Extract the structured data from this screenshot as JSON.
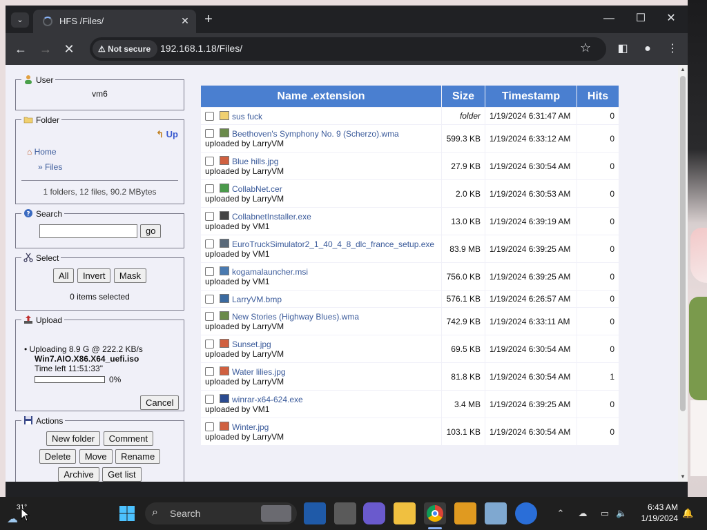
{
  "browser": {
    "tab_title": "HFS /Files/",
    "security_label": "Not secure",
    "url": "192.168.1.18/Files/"
  },
  "user_panel": {
    "legend": "User",
    "username": "vm6"
  },
  "folder_panel": {
    "legend": "Folder",
    "up_label": "Up",
    "home_label": "Home",
    "current_label": "» Files",
    "summary": "1 folders, 12 files, 90.2 MBytes"
  },
  "search_panel": {
    "legend": "Search",
    "go_label": "go",
    "query": ""
  },
  "select_panel": {
    "legend": "Select",
    "all_label": "All",
    "invert_label": "Invert",
    "mask_label": "Mask",
    "status": "0 items selected"
  },
  "upload_panel": {
    "legend": "Upload",
    "line1": "Uploading 8.9 G @ 222.2 KB/s",
    "filename": "Win7.AIO.X86.X64_uefi.iso",
    "time_left": "Time left 11:51:33\"",
    "progress_text": "0%",
    "progress_fraction": 0,
    "cancel_label": "Cancel"
  },
  "actions_panel": {
    "legend": "Actions",
    "new_folder": "New folder",
    "comment": "Comment",
    "delete": "Delete",
    "move": "Move",
    "rename": "Rename",
    "archive": "Archive",
    "get_list": "Get list"
  },
  "table": {
    "headers": [
      "Name .extension",
      "Size",
      "Timestamp",
      "Hits"
    ],
    "rows": [
      {
        "name": "sus fuck",
        "by": "",
        "size": "folder",
        "time": "1/19/2024 6:31:47 AM",
        "hits": "0",
        "icon": "folder-icon"
      },
      {
        "name": "Beethoven's Symphony No. 9 (Scherzo).wma",
        "by": "uploaded by LarryVM",
        "size": "599.3 KB",
        "time": "1/19/2024 6:33:12 AM",
        "hits": "0",
        "icon": "audio-file-icon"
      },
      {
        "name": "Blue hills.jpg",
        "by": "uploaded by LarryVM",
        "size": "27.9 KB",
        "time": "1/19/2024 6:30:54 AM",
        "hits": "0",
        "icon": "image-file-icon"
      },
      {
        "name": "CollabNet.cer",
        "by": "uploaded by LarryVM",
        "size": "2.0 KB",
        "time": "1/19/2024 6:30:53 AM",
        "hits": "0",
        "icon": "certificate-file-icon"
      },
      {
        "name": "CollabnetInstaller.exe",
        "by": "uploaded by VM1",
        "size": "13.0 KB",
        "time": "1/19/2024 6:39:19 AM",
        "hits": "0",
        "icon": "exe-file-icon"
      },
      {
        "name": "EuroTruckSimulator2_1_40_4_8_dlc_france_setup.exe",
        "by": "uploaded by VM1",
        "size": "83.9 MB",
        "time": "1/19/2024 6:39:25 AM",
        "hits": "0",
        "icon": "installer-file-icon"
      },
      {
        "name": "kogamalauncher.msi",
        "by": "uploaded by VM1",
        "size": "756.0 KB",
        "time": "1/19/2024 6:39:25 AM",
        "hits": "0",
        "icon": "msi-file-icon"
      },
      {
        "name": "LarryVM.bmp",
        "by": "",
        "size": "576.1 KB",
        "time": "1/19/2024 6:26:57 AM",
        "hits": "0",
        "icon": "bitmap-file-icon"
      },
      {
        "name": "New Stories (Highway Blues).wma",
        "by": "uploaded by LarryVM",
        "size": "742.9 KB",
        "time": "1/19/2024 6:33:11 AM",
        "hits": "0",
        "icon": "audio-file-icon"
      },
      {
        "name": "Sunset.jpg",
        "by": "uploaded by LarryVM",
        "size": "69.5 KB",
        "time": "1/19/2024 6:30:54 AM",
        "hits": "0",
        "icon": "image-file-icon"
      },
      {
        "name": "Water lilies.jpg",
        "by": "uploaded by LarryVM",
        "size": "81.8 KB",
        "time": "1/19/2024 6:30:54 AM",
        "hits": "1",
        "icon": "image-file-icon"
      },
      {
        "name": "winrar-x64-624.exe",
        "by": "uploaded by VM1",
        "size": "3.4 MB",
        "time": "1/19/2024 6:39:25 AM",
        "hits": "0",
        "icon": "window-file-icon"
      },
      {
        "name": "Winter.jpg",
        "by": "uploaded by LarryVM",
        "size": "103.1 KB",
        "time": "1/19/2024 6:30:54 AM",
        "hits": "0",
        "icon": "image-file-icon"
      }
    ]
  },
  "taskbar": {
    "weather_temp": "31°",
    "search_label": "Search",
    "clock_time": "6:43 AM",
    "clock_date": "1/19/2024"
  },
  "colors": {
    "header_blue": "#4a7fd0",
    "link_blue": "#3a5a9a",
    "chrome_dark": "#202124",
    "chrome_toolbar": "#35363a"
  }
}
